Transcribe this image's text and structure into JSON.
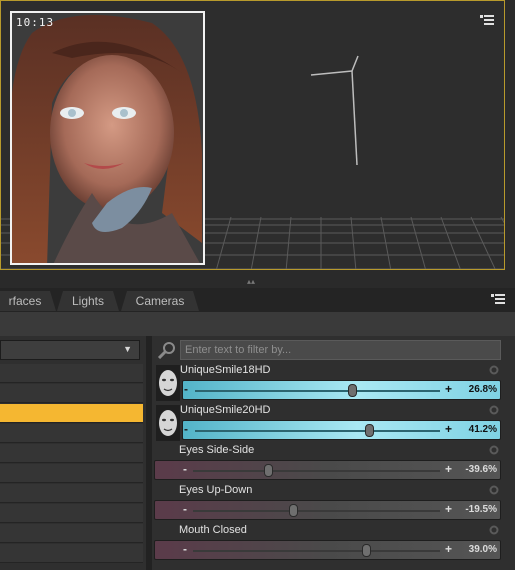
{
  "viewport": {
    "aux_time": "10:13",
    "menu_icon": "panel-menu-icon"
  },
  "tabs": [
    {
      "label": "rfaces"
    },
    {
      "label": "Lights"
    },
    {
      "label": "Cameras"
    }
  ],
  "panel": {
    "menu_icon": "panel-menu-icon",
    "category_select": {
      "selected": "",
      "icon": "chevron-down-icon"
    },
    "list_rows": [
      {
        "label": "",
        "selected": false
      },
      {
        "label": "",
        "selected": false
      },
      {
        "label": "",
        "selected": true
      },
      {
        "label": "",
        "selected": false
      },
      {
        "label": "",
        "selected": false
      },
      {
        "label": "",
        "selected": false
      },
      {
        "label": "",
        "selected": false
      },
      {
        "label": "",
        "selected": false
      },
      {
        "label": "",
        "selected": false
      },
      {
        "label": "",
        "selected": false
      }
    ],
    "filter": {
      "placeholder": "Enter text to filter by...",
      "value": "",
      "icon": "search-icon"
    },
    "properties": [
      {
        "name": "UniqueSmile18HD",
        "value_text": "26.8%",
        "value": 0.268,
        "thumbnail": true
      },
      {
        "name": "UniqueSmile20HD",
        "value_text": "41.2%",
        "value": 0.412,
        "thumbnail": true
      },
      {
        "name": "Eyes Side-Side",
        "value_text": "-39.6%",
        "value": -0.396,
        "thumbnail": false
      },
      {
        "name": "Eyes Up-Down",
        "value_text": "-19.5%",
        "value": -0.195,
        "thumbnail": false
      },
      {
        "name": "Mouth Closed",
        "value_text": "39.0%",
        "value": 0.39,
        "thumbnail": false
      }
    ],
    "minus_label": "-",
    "plus_label": "+"
  },
  "colors": {
    "accent_selection": "#f5b731",
    "viewport_border": "#b89a2c",
    "morph_slider": "#7fd2e3"
  }
}
